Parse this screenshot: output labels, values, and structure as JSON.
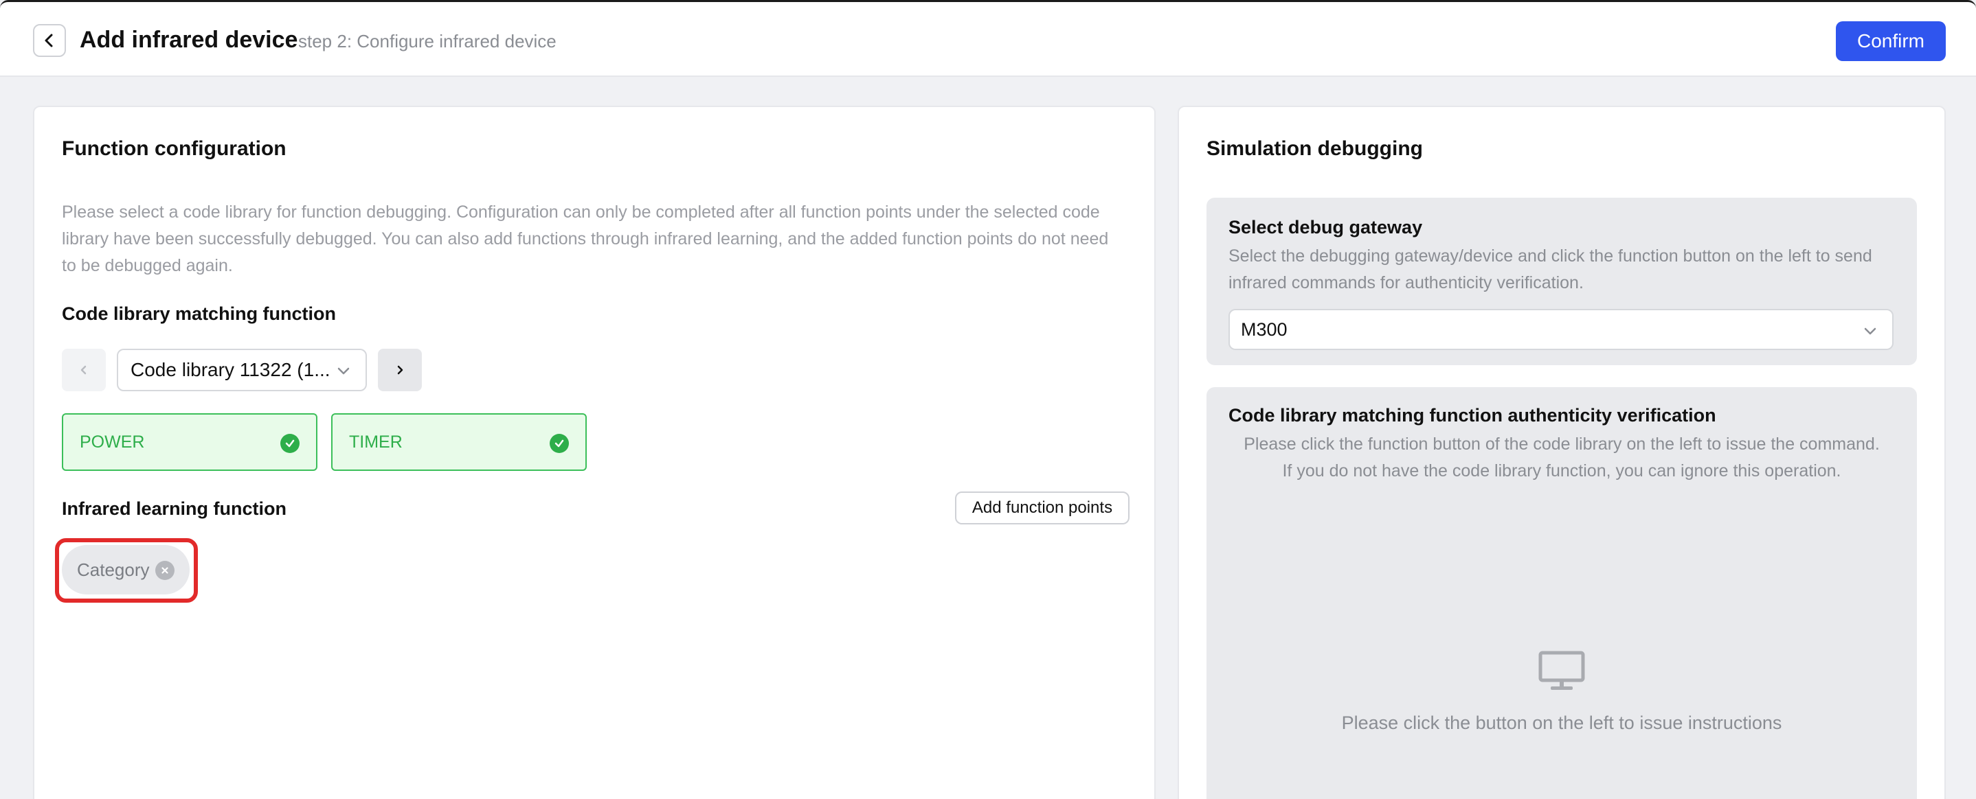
{
  "header": {
    "title": "Add infrared device",
    "subtitle": "step 2: Configure infrared device",
    "confirm_label": "Confirm"
  },
  "function_config": {
    "title": "Function configuration",
    "description_lines": [
      "Please select a code library for function debugging. Configuration can only be completed after all function points under the selected code",
      "library have been successfully debugged. You can also add functions through infrared learning, and the added function points do not need",
      "to be debugged again."
    ],
    "code_library_section_title": "Code library matching function",
    "code_library_selected": "Code library 11322 (1...",
    "function_points": [
      {
        "label": "POWER",
        "status": "verified"
      },
      {
        "label": "TIMER",
        "status": "verified"
      }
    ],
    "infrared_section_title": "Infrared learning function",
    "add_points_label": "Add function points",
    "learned_tags": [
      "Category"
    ]
  },
  "simulation": {
    "title": "Simulation debugging",
    "gateway": {
      "title": "Select debug gateway",
      "description_lines": [
        "Select the debugging gateway/device and click the function button on the left to send",
        "infrared commands for authenticity verification."
      ],
      "selected": "M300"
    },
    "verification": {
      "title": "Code library matching function authenticity verification",
      "hint_lines": [
        "Please click the function button of the code library on the left to issue the command.",
        "If you do not have the code library function, you can ignore this operation."
      ],
      "empty_message": "Please click the button on the left to issue instructions"
    }
  },
  "colors": {
    "primary": "#2f55ee",
    "success": "#2eae4a",
    "success_bg": "#e8fbe9",
    "highlight": "#e22a2a"
  },
  "icons": {
    "back": "chevron-left-icon",
    "dropdown": "chevron-down-icon",
    "next": "chevron-right-icon",
    "prev": "chevron-left-icon",
    "check": "check-circle-icon",
    "remove": "close-circle-icon",
    "monitor": "monitor-icon"
  }
}
